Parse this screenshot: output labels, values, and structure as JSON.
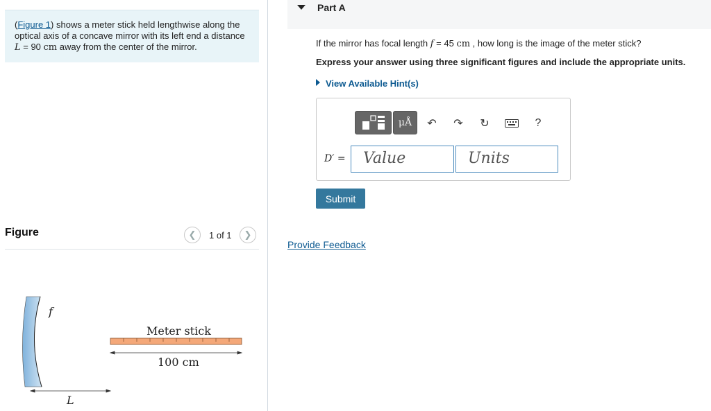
{
  "intro": {
    "link": "Figure 1",
    "open_paren": "(",
    "close_paren": ")",
    "text1": " shows a meter stick held lengthwise along the optical axis of a concave mirror with its left end a distance ",
    "L_symbol": "L",
    "text2": " = 90 ",
    "unit": "cm",
    "text3": " away from the center of the mirror."
  },
  "figure": {
    "title": "Figure",
    "counter": "1 of 1",
    "label_f": "f",
    "label_meter_stick": "Meter stick",
    "label_length": "100 cm",
    "label_L": "L"
  },
  "part": {
    "title": "Part A",
    "question_pre": "If the mirror has focal length ",
    "f_symbol": "f",
    "question_mid": " = 45 ",
    "unit": "cm",
    "question_post": " , how long is the image of the meter stick?",
    "instruction": "Express your answer using three significant figures and include the appropriate units.",
    "hints_label": "View Available Hint(s)"
  },
  "answer": {
    "label": "D′ =",
    "value_placeholder": "Value",
    "units_placeholder": "Units",
    "units_button": "μÅ",
    "help": "?"
  },
  "submit_label": "Submit",
  "feedback_label": "Provide Feedback"
}
